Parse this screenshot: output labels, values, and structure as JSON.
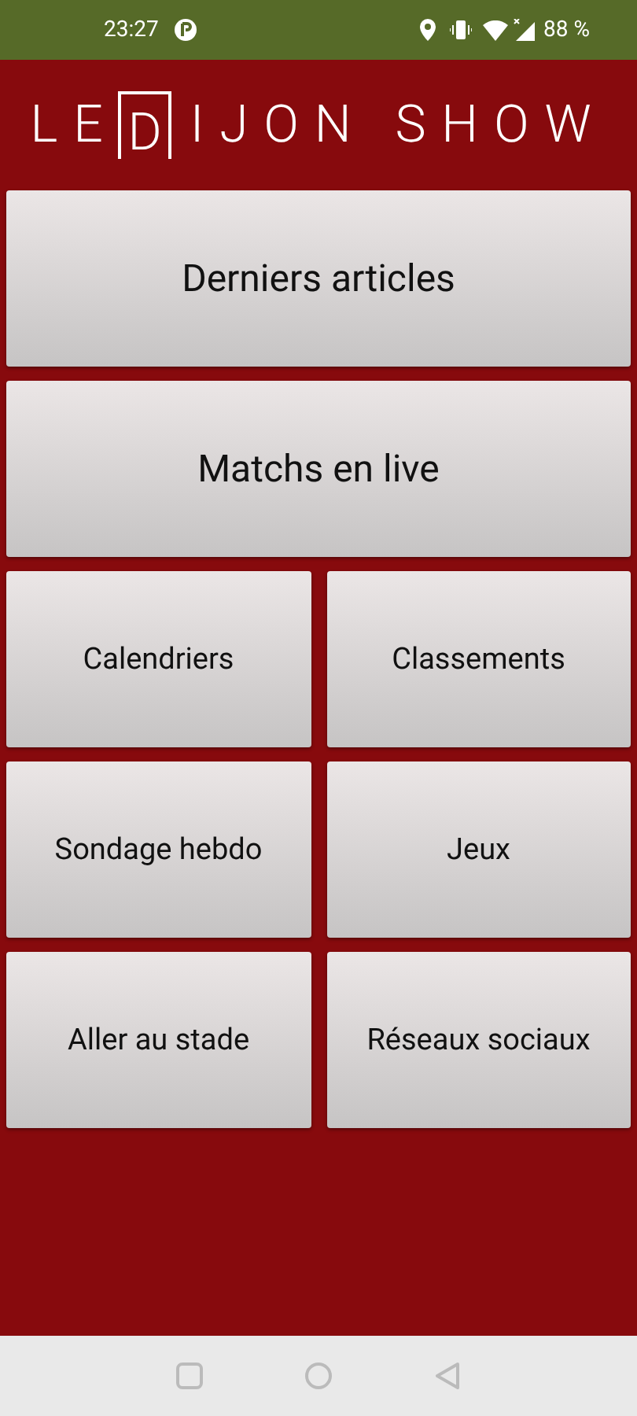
{
  "status_bar": {
    "time": "23:27",
    "battery": "88 %"
  },
  "logo": {
    "before": "LE",
    "initial": "D",
    "after": "IJON SHOW"
  },
  "menu": [
    {
      "label": "Derniers articles",
      "kind": "wide"
    },
    {
      "label": "Matchs en live",
      "kind": "wide"
    },
    {
      "label": "Calendriers",
      "kind": "half"
    },
    {
      "label": "Classements",
      "kind": "half"
    },
    {
      "label": "Sondage hebdo",
      "kind": "half"
    },
    {
      "label": "Jeux",
      "kind": "half"
    },
    {
      "label": "Aller au stade",
      "kind": "half"
    },
    {
      "label": "Réseaux sociaux",
      "kind": "half"
    }
  ]
}
